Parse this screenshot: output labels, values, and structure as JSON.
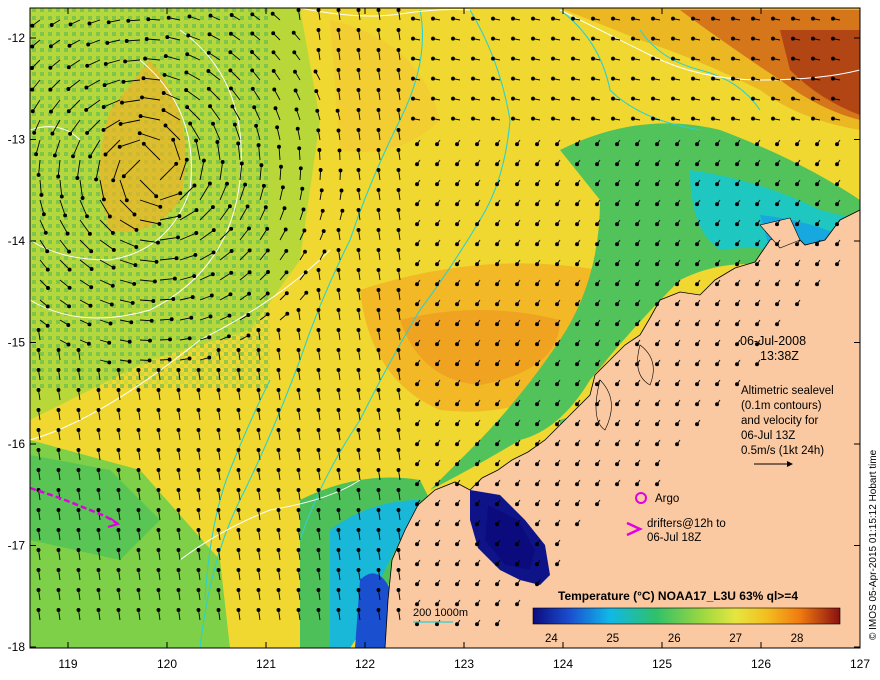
{
  "map": {
    "date_label": "06-Jul-2008",
    "time_label": "13:38Z",
    "altimetry_lines": [
      "Altimetric sealevel",
      "(0.1m contours)",
      "and velocity for",
      "06-Jul 13Z",
      "0.5m/s (1kt 24h)"
    ],
    "argo_label": "Argo",
    "drifter_lines": [
      "drifters@12h to",
      "06-Jul 18Z"
    ],
    "bathymetry_label": "200  1000m",
    "credit": "© IMOS 05-Apr-2015 01:15:12 Hobart time"
  },
  "colorbar": {
    "title": "Temperature (°C) NOAA17_L3U 63% ql>=4",
    "ticks": [
      "24",
      "25",
      "26",
      "27",
      "28"
    ],
    "range": [
      23.7,
      28.7
    ]
  },
  "axes": {
    "x_ticks": [
      "119",
      "120",
      "121",
      "122",
      "123",
      "124",
      "125",
      "126",
      "127"
    ],
    "y_ticks": [
      "-12",
      "-13",
      "-14",
      "-15",
      "-16",
      "-17",
      "-18"
    ]
  },
  "colors": {
    "land": "#fbc9a1",
    "frame": "#000000",
    "contour": "#ffffff",
    "bathymetry": "#2dd0d0",
    "argo_marker": "#e000e0",
    "drifter": "#e000e0",
    "palette": [
      "#0b0b7e",
      "#1a4fd0",
      "#10b8e8",
      "#2fc06a",
      "#78d040",
      "#d8e040",
      "#f0c020",
      "#f08a10",
      "#c02a10",
      "#8a1010"
    ]
  }
}
